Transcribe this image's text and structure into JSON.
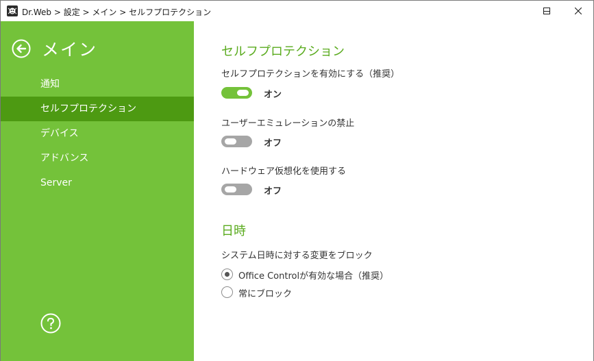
{
  "titlebar": {
    "title": "Dr.Web > 設定 > メイン > セルフプロテクション",
    "minimize_icon": "minimize-icon",
    "maximize_icon": "maximize-icon",
    "close_icon": "close-icon"
  },
  "sidebar": {
    "title": "メイン",
    "back_icon": "back-arrow-icon",
    "help_icon": "help-icon",
    "items": [
      {
        "label": "通知",
        "active": false
      },
      {
        "label": "セルフプロテクション",
        "active": true
      },
      {
        "label": "デバイス",
        "active": false
      },
      {
        "label": "アドバンス",
        "active": false
      },
      {
        "label": "Server",
        "active": false
      }
    ]
  },
  "main": {
    "section1_title": "セルフプロテクション",
    "settings": [
      {
        "label": "セルフプロテクションを有効にする（推奨）",
        "state": "オン",
        "on": true
      },
      {
        "label": "ユーザーエミュレーションの禁止",
        "state": "オフ",
        "on": false
      },
      {
        "label": "ハードウェア仮想化を使用する",
        "state": "オフ",
        "on": false
      }
    ],
    "section2_title": "日時",
    "datetime_label": "システム日時に対する変更をブロック",
    "radio_options": [
      {
        "label": "Office Controlが有効な場合（推奨）",
        "selected": true
      },
      {
        "label": "常にブロック",
        "selected": false
      }
    ]
  },
  "colors": {
    "sidebar_bg": "#74c23a",
    "sidebar_active": "#4d9a12",
    "accent_text": "#5aab1e",
    "toggle_off": "#a6a6a6"
  }
}
